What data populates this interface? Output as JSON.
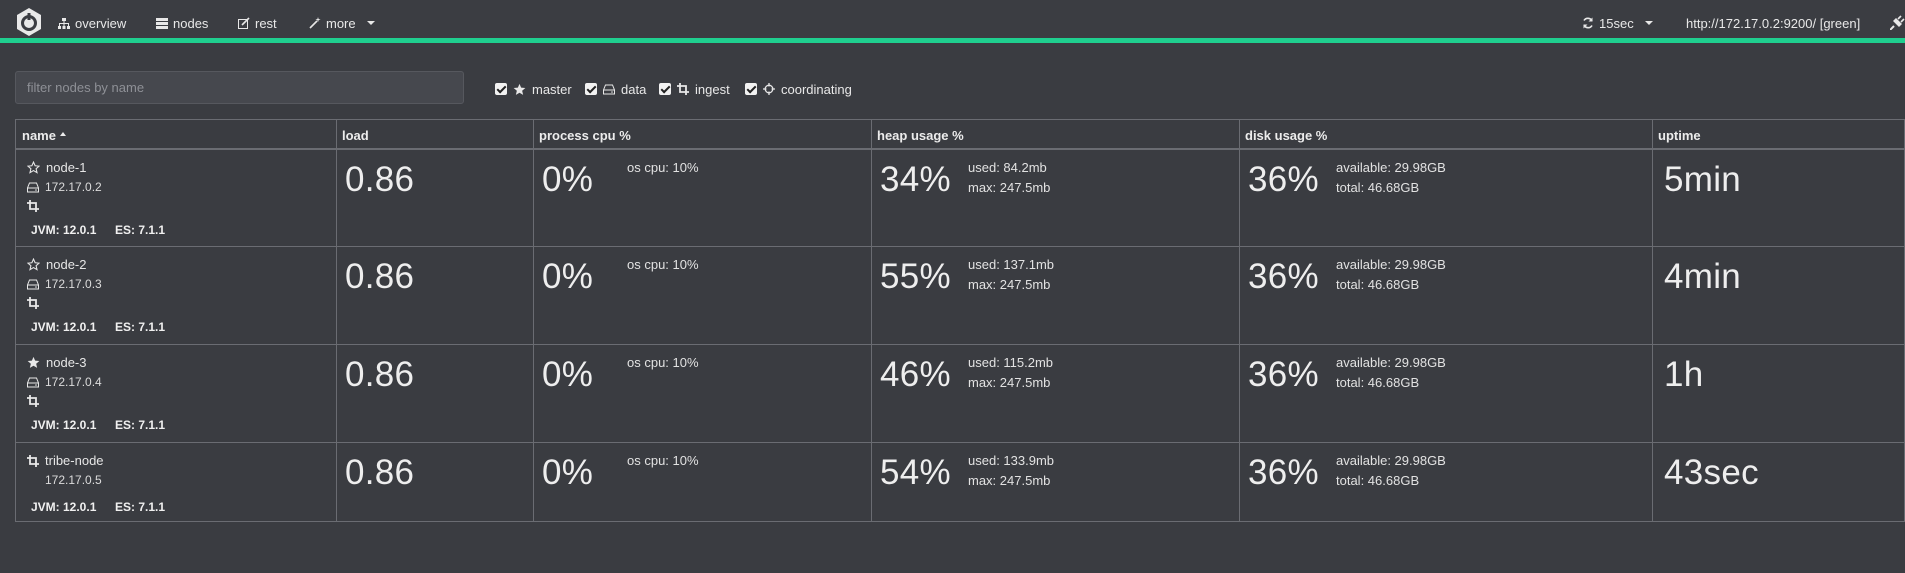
{
  "nav": {
    "items": [
      {
        "label": "overview",
        "icon": "sitemap-icon"
      },
      {
        "label": "nodes",
        "icon": "server-icon"
      },
      {
        "label": "rest",
        "icon": "edit-icon"
      },
      {
        "label": "more",
        "icon": "magic-wand-icon"
      }
    ],
    "refresh_label": "15sec",
    "cluster_url": "http://172.17.0.2:9200/ [green]"
  },
  "colors": {
    "accent": "#1fcf8f",
    "background": "#3a3c41"
  },
  "filter": {
    "placeholder": "filter nodes by name"
  },
  "roles": [
    {
      "label": "master",
      "checked": true,
      "icon": "star-icon"
    },
    {
      "label": "data",
      "checked": true,
      "icon": "hdd-icon"
    },
    {
      "label": "ingest",
      "checked": true,
      "icon": "crop-icon"
    },
    {
      "label": "coordinating",
      "checked": true,
      "icon": "crosshairs-icon"
    }
  ],
  "columns": [
    "name",
    "load",
    "process cpu %",
    "heap usage %",
    "disk usage %",
    "uptime"
  ],
  "nodes": [
    {
      "name": "node-1",
      "ip": "172.17.0.2",
      "master_icon": "star-outline-icon",
      "jvm": "JVM: 12.0.1",
      "es": "ES: 7.1.1",
      "load": "0.86",
      "cpu": "0%",
      "os_cpu": "os cpu: 10%",
      "heap": "34%",
      "heap_used": "used: 84.2mb",
      "heap_max": "max: 247.5mb",
      "disk": "36%",
      "disk_avail": "available: 29.98GB",
      "disk_total": "total: 46.68GB",
      "uptime": "5min"
    },
    {
      "name": "node-2",
      "ip": "172.17.0.3",
      "master_icon": "star-outline-icon",
      "jvm": "JVM: 12.0.1",
      "es": "ES: 7.1.1",
      "load": "0.86",
      "cpu": "0%",
      "os_cpu": "os cpu: 10%",
      "heap": "55%",
      "heap_used": "used: 137.1mb",
      "heap_max": "max: 247.5mb",
      "disk": "36%",
      "disk_avail": "available: 29.98GB",
      "disk_total": "total: 46.68GB",
      "uptime": "4min"
    },
    {
      "name": "node-3",
      "ip": "172.17.0.4",
      "master_icon": "star-filled-icon",
      "jvm": "JVM: 12.0.1",
      "es": "ES: 7.1.1",
      "load": "0.86",
      "cpu": "0%",
      "os_cpu": "os cpu: 10%",
      "heap": "46%",
      "heap_used": "used: 115.2mb",
      "heap_max": "max: 247.5mb",
      "disk": "36%",
      "disk_avail": "available: 29.98GB",
      "disk_total": "total: 46.68GB",
      "uptime": "1h"
    },
    {
      "name": "tribe-node",
      "ip": "172.17.0.5",
      "master_icon": "crop-icon",
      "jvm": "JVM: 12.0.1",
      "es": "ES: 7.1.1",
      "load": "0.86",
      "cpu": "0%",
      "os_cpu": "os cpu: 10%",
      "heap": "54%",
      "heap_used": "used: 133.9mb",
      "heap_max": "max: 247.5mb",
      "disk": "36%",
      "disk_avail": "available: 29.98GB",
      "disk_total": "total: 46.68GB",
      "uptime": "43sec"
    }
  ]
}
